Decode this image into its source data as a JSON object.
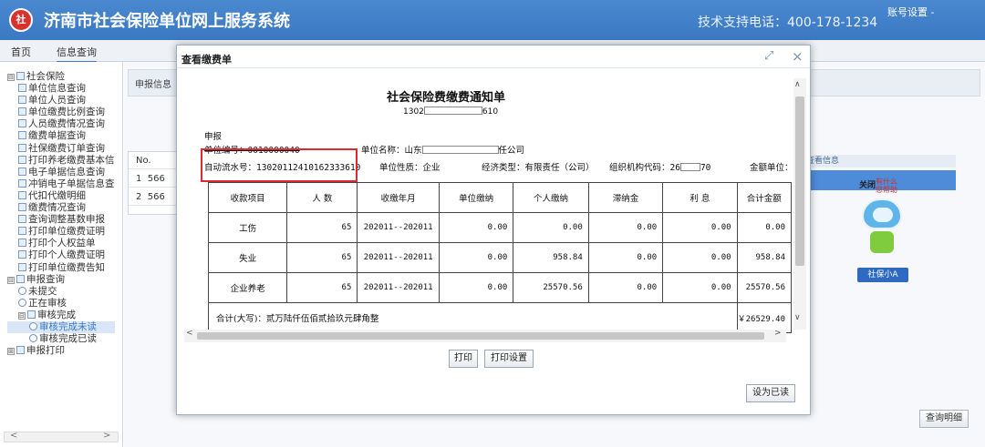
{
  "header": {
    "logo_text": "社",
    "title": "济南市社会保险单位网上服务系统",
    "hotline": "技术支持电话：400-178-1234",
    "account": "账号设置 -"
  },
  "tabs": [
    {
      "label": "首页"
    },
    {
      "label": "信息查询"
    }
  ],
  "sidebar": {
    "items": [
      {
        "label": "社会保险",
        "expand": "⊟"
      },
      {
        "label": "单位信息查询"
      },
      {
        "label": "单位人员查询"
      },
      {
        "label": "单位缴费比例查询"
      },
      {
        "label": "人员缴费情况查询"
      },
      {
        "label": "缴费单据查询"
      },
      {
        "label": "社保缴费订单查询"
      },
      {
        "label": "打印养老缴费基本信"
      },
      {
        "label": "电子单据信息查询"
      },
      {
        "label": "冲销电子单据信息查"
      },
      {
        "label": "代扣代缴明细"
      },
      {
        "label": "缴费情况查询"
      },
      {
        "label": "查询调整基数申报"
      },
      {
        "label": "打印单位缴费证明"
      },
      {
        "label": "打印个人权益单"
      },
      {
        "label": "打印个人缴费证明"
      },
      {
        "label": "打印单位缴费告知"
      },
      {
        "label": "申报查询",
        "expand": "⊟"
      },
      {
        "label": "未提交"
      },
      {
        "label": "正在审核"
      },
      {
        "label": "审核完成",
        "expand": "⊟"
      },
      {
        "label": "审核完成未读"
      },
      {
        "label": "审核完成已读"
      },
      {
        "label": "申报打印",
        "expand": "⊞"
      }
    ],
    "scroll_left": "<",
    "scroll_right": ">"
  },
  "background": {
    "panel_label": "申报信息",
    "grid_header": "No.",
    "rows": [
      {
        "no": "1",
        "code": "566"
      },
      {
        "no": "2",
        "code": "566"
      }
    ],
    "right_head": "查看信息",
    "close_label": "关闭",
    "bubble_line1": "有什么",
    "bubble_line2": "您帮助",
    "robot_label": "社保小A",
    "detail_button": "查询明细"
  },
  "modal": {
    "title": "查看缴费单",
    "max_icon": "⤢",
    "close_icon": "×",
    "doc": {
      "title": "社会保险费缴费通知单",
      "sub_prefix": "1302",
      "sub_suffix": "610",
      "declare": "申报",
      "unit_code": "单位编号：0010000040",
      "unit_name_prefix": "单位名称：山东",
      "unit_name_suffix": "任公司",
      "serial": "自动流水号：13020112410162333610",
      "unit_nature": "单位性质：企业",
      "econ_type": "经济类型：有限责任（公司）",
      "org_code_prefix": "组织机构代码：26",
      "org_code_suffix": "70",
      "amount_unit": "金额单位："
    },
    "table": {
      "headers": [
        "收款项目",
        "人 数",
        "收缴年月",
        "单位缴纳",
        "个人缴纳",
        "滞纳金",
        "利 息",
        "合计金额"
      ],
      "rows": [
        [
          "工伤",
          "65",
          "202011--202011",
          "0.00",
          "0.00",
          "0.00",
          "0.00",
          "0.00"
        ],
        [
          "失业",
          "65",
          "202011--202011",
          "0.00",
          "958.84",
          "0.00",
          "0.00",
          "958.84"
        ],
        [
          "企业养老",
          "65",
          "202011--202011",
          "0.00",
          "25570.56",
          "0.00",
          "0.00",
          "25570.56"
        ]
      ],
      "total_label": "合计(大写)：贰万陆仟伍佰贰拾玖元肆角整",
      "total_value": "￥26529.40"
    },
    "scroll": {
      "up": "∧",
      "down": "∨",
      "left": "<",
      "right": ">"
    },
    "buttons": {
      "print": "打印",
      "print_settings": "打印设置",
      "mark_read": "设为已读"
    }
  }
}
